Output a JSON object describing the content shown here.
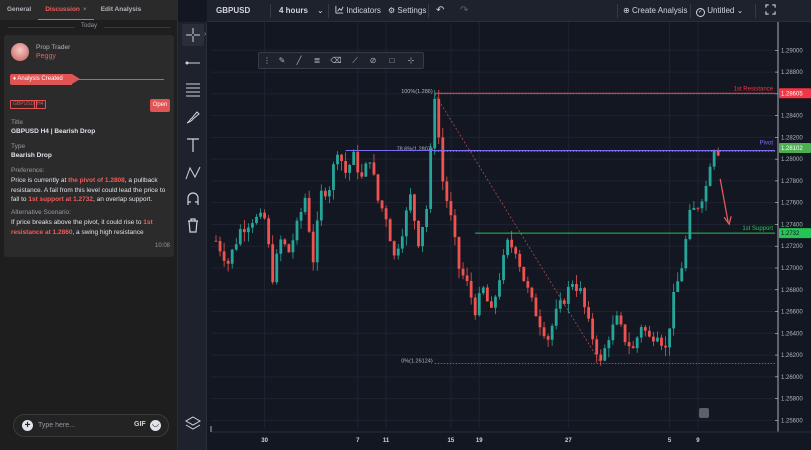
{
  "left_panel": {
    "tabs": [
      {
        "label": "General"
      },
      {
        "label": "Discussion",
        "close": "×"
      },
      {
        "label": "Edit Analysis"
      }
    ],
    "date_separator": "Today",
    "post": {
      "role": "Prop Trader",
      "username": "Peggy",
      "status": "Analysis Created",
      "tags": [
        "GBPUSD",
        "H4"
      ],
      "open_label": "Open",
      "title_label": "Title",
      "title_value": "GBPUSD H4 | Bearish Drop",
      "type_label": "Type",
      "type_value": "Bearish Drop",
      "preference_label": "Preference:",
      "preference": {
        "t1": "Price is currently at ",
        "h1": "the pivot of 1.2808",
        "t2": ", a pullback resistance. A fail from this level could lead the price to fall to ",
        "h2": "1st support at 1.2732",
        "t3": ", an overlap support."
      },
      "alternative_label": "Alternative Scenario:",
      "alternative": {
        "t1": "If price breaks above the pivot, it could rise to ",
        "h1": "1st resistance at 1.2860",
        "t2": ", a swing high resistance"
      },
      "time": "10:08"
    },
    "message_input": {
      "placeholder": "Type here...",
      "value": ""
    },
    "gif_label": "GIF"
  },
  "header": {
    "symbol": "GBPUSD",
    "interval": "4 hours",
    "indicators_label": "Indicators",
    "settings_label": "Settings",
    "create_label": "Create Analysis",
    "title_label": "Untitled"
  },
  "colors": {
    "bull": "#26a69a",
    "bear": "#ef5350",
    "resistance": "#f23645",
    "pivot": "#7b6ff0",
    "support": "#26c455",
    "arrow": "#f05c5c",
    "accent": "#e05454"
  },
  "icons": [
    "crosshair-icon",
    "horizontal-line-icon",
    "fib-icon",
    "brush-icon",
    "text-icon",
    "pattern-icon",
    "magnet-icon",
    "trash-icon",
    "layers-icon",
    "undo-icon",
    "redo-icon",
    "fullscreen-icon",
    "plus-circle-icon",
    "check-icon",
    "chevron-down-icon",
    "smiley-icon"
  ],
  "chart_data": {
    "type": "candlestick",
    "symbol": "GBPUSD",
    "timeframe": "4 hours",
    "ylim": [
      1.2553,
      1.2926
    ],
    "y_ticks": [
      1.29,
      1.288,
      1.286,
      1.284,
      1.282,
      1.28,
      1.278,
      1.276,
      1.274,
      1.272,
      1.27,
      1.268,
      1.266,
      1.264,
      1.262,
      1.26,
      1.258,
      1.256
    ],
    "y_tick_labels": [
      "1.29000",
      "1.28800",
      "1.28600",
      "1.28400",
      "1.28200",
      "1.28000",
      "1.27800",
      "1.27600",
      "1.27400",
      "1.27200",
      "1.27000",
      "1.26800",
      "1.26600",
      "1.26400",
      "1.26200",
      "1.26000",
      "1.25800",
      "1.25600"
    ],
    "x_ticks": [
      {
        "label": "30",
        "bar": 12
      },
      {
        "label": "7",
        "bar": 35
      },
      {
        "label": "11",
        "bar": 42
      },
      {
        "label": "15",
        "bar": 58
      },
      {
        "label": "19",
        "bar": 65
      },
      {
        "label": "27",
        "bar": 87
      },
      {
        "label": "5",
        "bar": 112
      },
      {
        "label": "9",
        "bar": 119
      }
    ],
    "num_bars": 125,
    "key_points": [
      [
        0,
        1.2725
      ],
      [
        3,
        1.2705
      ],
      [
        6,
        1.2735
      ],
      [
        9,
        1.2745
      ],
      [
        12,
        1.2745
      ],
      [
        14,
        1.2692
      ],
      [
        16,
        1.2725
      ],
      [
        18,
        1.2715
      ],
      [
        20,
        1.2738
      ],
      [
        22,
        1.2765
      ],
      [
        24,
        1.2708
      ],
      [
        26,
        1.2768
      ],
      [
        28,
        1.2775
      ],
      [
        30,
        1.281
      ],
      [
        32,
        1.2788
      ],
      [
        34,
        1.2802
      ],
      [
        36,
        1.2782
      ],
      [
        38,
        1.2802
      ],
      [
        40,
        1.2762
      ],
      [
        42,
        1.2748
      ],
      [
        44,
        1.271
      ],
      [
        46,
        1.2735
      ],
      [
        48,
        1.2765
      ],
      [
        50,
        1.2725
      ],
      [
        52,
        1.2755
      ],
      [
        53,
        1.2805
      ],
      [
        54,
        1.286
      ],
      [
        56,
        1.278
      ],
      [
        58,
        1.2745
      ],
      [
        60,
        1.27
      ],
      [
        62,
        1.2685
      ],
      [
        64,
        1.2662
      ],
      [
        66,
        1.268
      ],
      [
        68,
        1.2658
      ],
      [
        70,
        1.2692
      ],
      [
        72,
        1.2722
      ],
      [
        74,
        1.2718
      ],
      [
        76,
        1.269
      ],
      [
        78,
        1.2668
      ],
      [
        80,
        1.265
      ],
      [
        82,
        1.2636
      ],
      [
        84,
        1.2658
      ],
      [
        86,
        1.2672
      ],
      [
        88,
        1.2688
      ],
      [
        90,
        1.2678
      ],
      [
        92,
        1.2648
      ],
      [
        94,
        1.2625
      ],
      [
        95,
        1.2612
      ],
      [
        97,
        1.2638
      ],
      [
        99,
        1.2652
      ],
      [
        101,
        1.2635
      ],
      [
        103,
        1.2625
      ],
      [
        105,
        1.2648
      ],
      [
        107,
        1.2635
      ],
      [
        109,
        1.2642
      ],
      [
        111,
        1.2625
      ],
      [
        113,
        1.2672
      ],
      [
        115,
        1.2702
      ],
      [
        117,
        1.2748
      ],
      [
        119,
        1.2758
      ],
      [
        121,
        1.2775
      ],
      [
        122,
        1.2798
      ],
      [
        123,
        1.2812
      ],
      [
        124,
        1.2808
      ]
    ],
    "fibonacci": [
      {
        "label": "100%(1.286)",
        "value": 1.286,
        "from_bar": 54,
        "to_bar": 124
      },
      {
        "label": "78.6%(1.2807)",
        "value": 1.2807,
        "from_bar": 54,
        "to_bar": 124
      },
      {
        "label": "0%(1.26124)",
        "value": 1.26124,
        "from_bar": 54,
        "to_bar": 124
      }
    ],
    "levels": [
      {
        "name": "1st Resistance",
        "value": 1.28605,
        "label": "1.28605",
        "color": "#f23645"
      },
      {
        "name": "Pivot",
        "value": 1.28102,
        "label": "1.28102",
        "color": "#7b6ff0"
      },
      {
        "name": "1st Support",
        "value": 1.2732,
        "label": "1.2732",
        "color": "#26c455"
      }
    ],
    "pivot_line_value": 1.2808,
    "pivot_line_start_bar": 32,
    "support_line_start_bar": 64,
    "fib_trendline": [
      [
        54,
        1.286
      ],
      [
        95,
        1.26124
      ]
    ],
    "forecast_arrow": [
      [
        1.2782,
        1.2742
      ]
    ]
  }
}
